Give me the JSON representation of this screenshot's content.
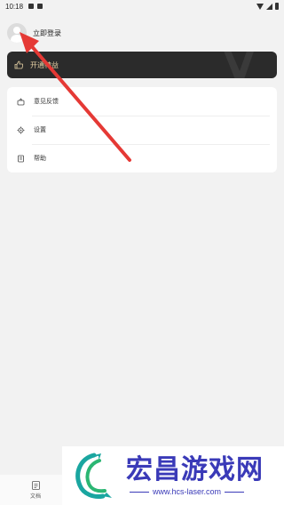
{
  "status_bar": {
    "time": "10:18"
  },
  "profile": {
    "login_label": "立即登录"
  },
  "vip": {
    "label": "开通特益"
  },
  "menu": [
    {
      "label": "意见反馈",
      "icon": "feedback-icon"
    },
    {
      "label": "设置",
      "icon": "gear-icon"
    },
    {
      "label": "帮助",
      "icon": "help-doc-icon"
    }
  ],
  "tabbar": {
    "docs_label": "文档"
  },
  "watermark": {
    "title": "宏昌游戏网",
    "url": "www.hcs-laser.com"
  },
  "colors": {
    "vip_bg": "#2b2b2b",
    "vip_text": "#e8d3a6",
    "arrow": "#e53935",
    "watermark": "#3a3ab8"
  }
}
